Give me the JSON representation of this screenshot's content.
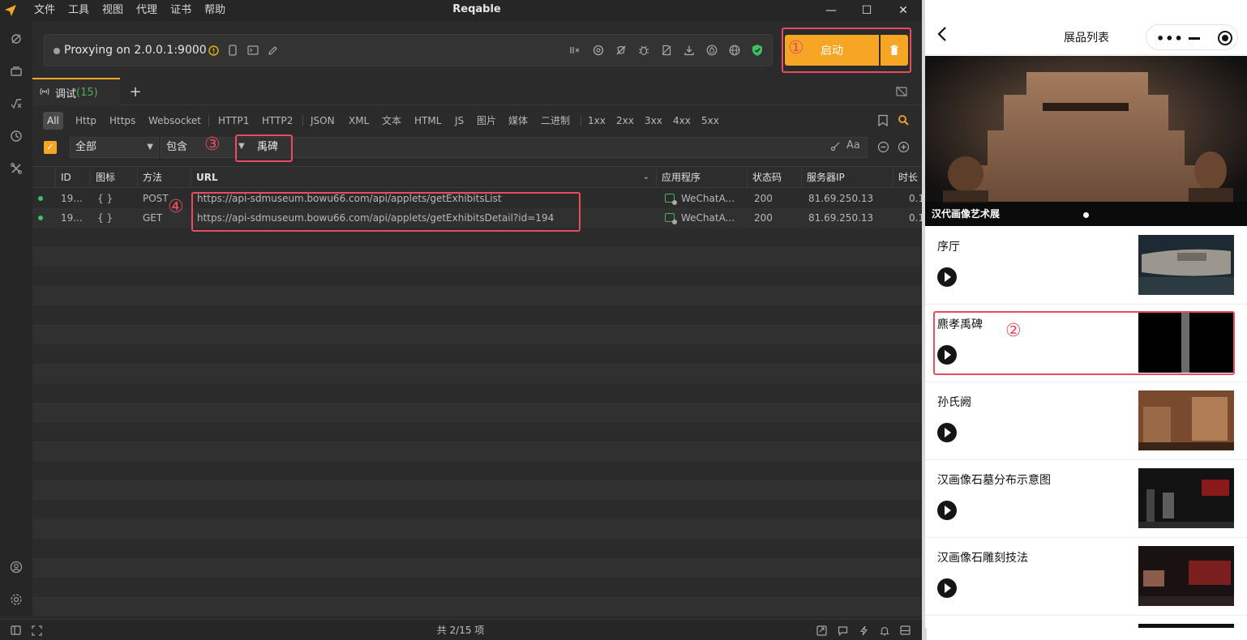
{
  "app": {
    "title": "Reqable",
    "menu": [
      "文件",
      "工具",
      "视图",
      "代理",
      "证书",
      "帮助"
    ],
    "window_controls": {
      "minimize": "—",
      "maximize": "☐",
      "close": "✕"
    }
  },
  "proxy": {
    "status_text": "Proxying on 2.0.0.1:9000",
    "start_label": "启动"
  },
  "tab": {
    "label": "调试",
    "count": "(15)"
  },
  "filters": {
    "chips": [
      "All",
      "Http",
      "Https",
      "Websocket",
      "HTTP1",
      "HTTP2",
      "JSON",
      "XML",
      "文本",
      "HTML",
      "JS",
      "图片",
      "媒体",
      "二进制",
      "1xx",
      "2xx",
      "3xx",
      "4xx",
      "5xx"
    ],
    "active": "All"
  },
  "search": {
    "scope": "全部",
    "mode": "包含",
    "keyword": "禹碑",
    "case_label": "Aa"
  },
  "table": {
    "headers": {
      "id": "ID",
      "icon": "图标",
      "method": "方法",
      "url": "URL",
      "app": "应用程序",
      "status": "状态码",
      "server_ip": "服务器IP",
      "duration": "时长"
    },
    "rows": [
      {
        "id": "19...",
        "icon": "{ }",
        "method": "POST",
        "url": "https://api-sdmuseum.bowu66.com/api/applets/getExhibitsList",
        "app": "WeChatA...",
        "status": "200",
        "server_ip": "81.69.250.13",
        "duration": "0.1"
      },
      {
        "id": "19...",
        "icon": "{ }",
        "method": "GET",
        "url": "https://api-sdmuseum.bowu66.com/api/applets/getExhibitsDetail?id=194",
        "app": "WeChatA...",
        "status": "200",
        "server_ip": "81.69.250.13",
        "duration": "0.1"
      }
    ]
  },
  "status_bar": {
    "count_text": "共 2/15 项"
  },
  "annotations": [
    "①",
    "②",
    "③",
    "④"
  ],
  "phone": {
    "nav_title": "展品列表",
    "banner": {
      "caption": "汉代画像艺术展",
      "plaque_text": "汉代画像艺术展"
    },
    "exhibits": [
      {
        "title": "序厅"
      },
      {
        "title": "麃孝禹碑"
      },
      {
        "title": "孙氏阙"
      },
      {
        "title": "汉画像石墓分布示意图"
      },
      {
        "title": "汉画像石雕刻技法"
      }
    ]
  },
  "colors": {
    "accent": "#f6a624",
    "annotation": "#e94c5e",
    "status_ok": "#3fbf5f"
  },
  "icons": {
    "logo": "paper-plane-icon",
    "leftbar": [
      "capture-icon",
      "layers-icon",
      "function-icon",
      "history-icon",
      "tools-icon",
      "user-icon",
      "settings-icon"
    ],
    "proxybar": [
      "warning-icon",
      "phone-icon",
      "terminal-icon",
      "edit-icon",
      "breakpoint-icon",
      "rewrite-icon",
      "block-icon",
      "bug-icon",
      "script-icon",
      "download-icon",
      "water-drop-icon",
      "globe-icon",
      "shield-icon"
    ]
  }
}
